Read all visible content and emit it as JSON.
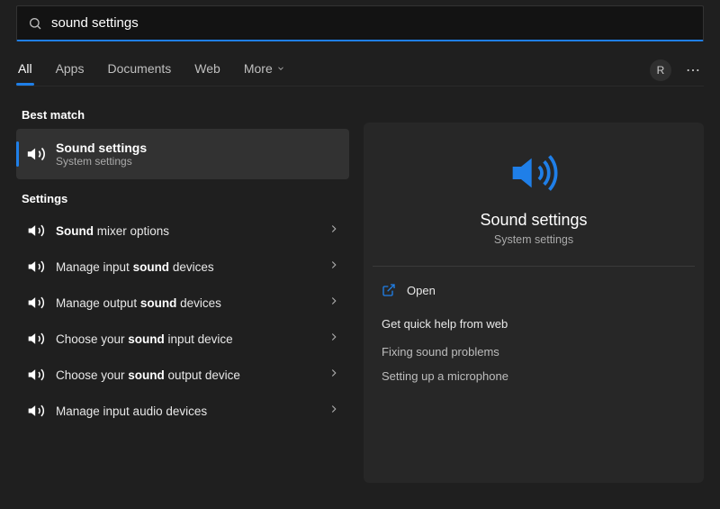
{
  "search": {
    "query": "sound settings"
  },
  "tabs": {
    "all": "All",
    "apps": "Apps",
    "documents": "Documents",
    "web": "Web",
    "more": "More"
  },
  "avatar_letter": "R",
  "left": {
    "best_match_label": "Best match",
    "best_match": {
      "title": "Sound settings",
      "subtitle": "System settings"
    },
    "settings_label": "Settings",
    "settings": [
      {
        "pre": "",
        "bold": "Sound",
        "post": " mixer options"
      },
      {
        "pre": "Manage input ",
        "bold": "sound",
        "post": " devices"
      },
      {
        "pre": "Manage output ",
        "bold": "sound",
        "post": " devices"
      },
      {
        "pre": "Choose your ",
        "bold": "sound",
        "post": " input device"
      },
      {
        "pre": "Choose your ",
        "bold": "sound",
        "post": " output device"
      },
      {
        "pre": "Manage input audio devices",
        "bold": "",
        "post": ""
      }
    ]
  },
  "preview": {
    "title": "Sound settings",
    "subtitle": "System settings",
    "open_label": "Open",
    "help_header": "Get quick help from web",
    "help_links": [
      "Fixing sound problems",
      "Setting up a microphone"
    ]
  }
}
